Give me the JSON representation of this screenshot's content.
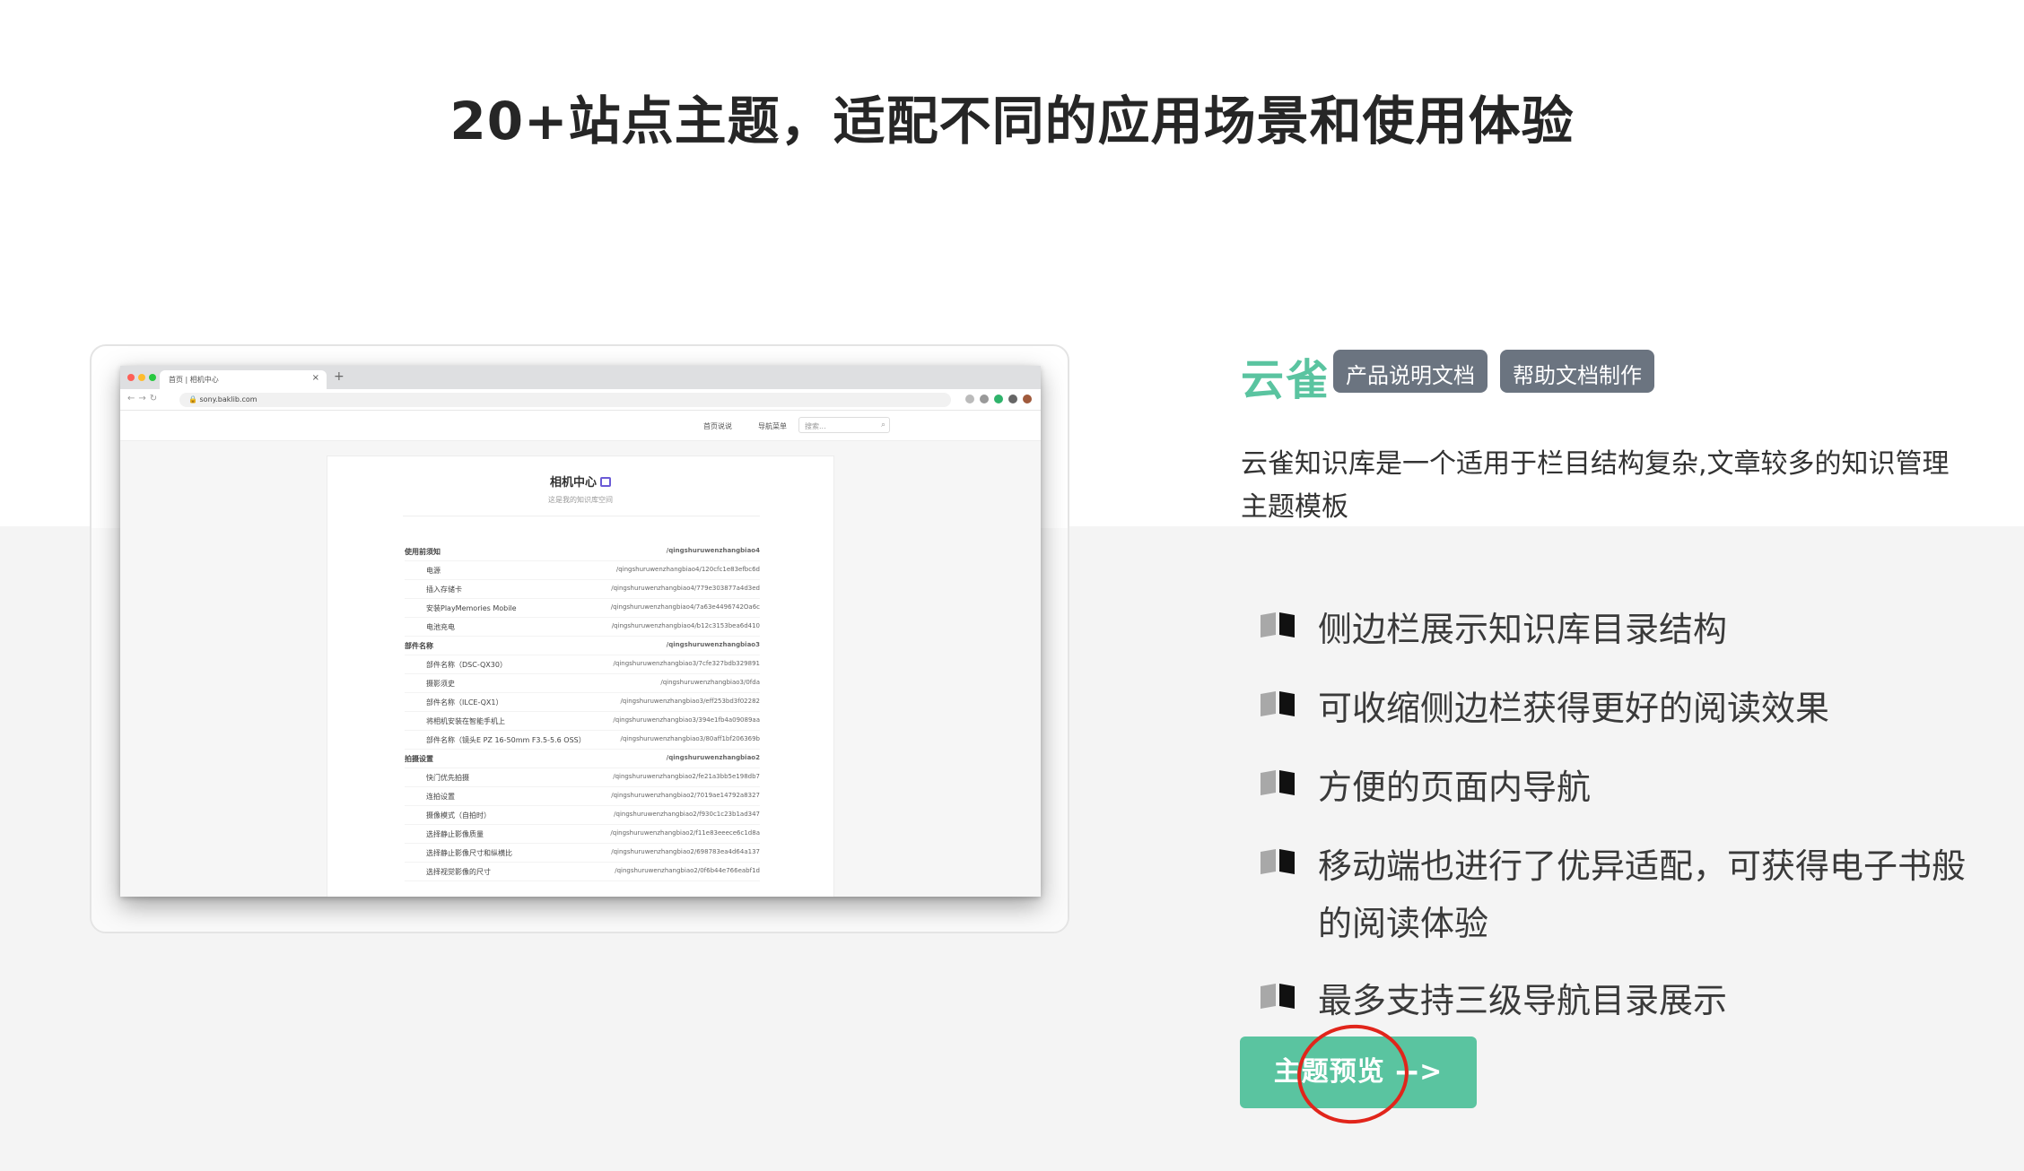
{
  "headline": "20+站点主题，适配不同的应用场景和使用体验",
  "colors": {
    "brand": "#5ac4a0",
    "tag_bg": "#6b7480",
    "annotation": "#e1251b"
  },
  "preview": {
    "tab_title": "首页 | 相机中心",
    "url": "sony.baklib.com",
    "menu_items": [
      "首页说说",
      "导航菜单"
    ],
    "search_placeholder": "搜索...",
    "site_title": "相机中心",
    "site_subtitle": "这是我的知识库空间",
    "rows": [
      {
        "level": 1,
        "title": "使用前须知",
        "path": "/qingshuruwenzhangbiao4"
      },
      {
        "level": 2,
        "title": "电源",
        "path": "/qingshuruwenzhangbiao4/120cfc1e83efbc6d"
      },
      {
        "level": 2,
        "title": "插入存储卡",
        "path": "/qingshuruwenzhangbiao4/779e303877a4d3ed"
      },
      {
        "level": 2,
        "title": "安装PlayMemories Mobile",
        "path": "/qingshuruwenzhangbiao4/7a63e4496742Oa6c"
      },
      {
        "level": 2,
        "title": "电池充电",
        "path": "/qingshuruwenzhangbiao4/b12c3153bea6d410"
      },
      {
        "level": 1,
        "title": "部件名称",
        "path": "/qingshuruwenzhangbiao3"
      },
      {
        "level": 2,
        "title": "部件名称（DSC-QX30）",
        "path": "/qingshuruwenzhangbiao3/7cfe327bdb329891"
      },
      {
        "level": 2,
        "title": "摄影须史",
        "path": "/qingshuruwenzhangbiao3/0fda"
      },
      {
        "level": 2,
        "title": "部件名称（ILCE-QX1）",
        "path": "/qingshuruwenzhangbiao3/eff253bd3f02282"
      },
      {
        "level": 2,
        "title": "将相机安装在智能手机上",
        "path": "/qingshuruwenzhangbiao3/394e1fb4a09089aa"
      },
      {
        "level": 2,
        "title": "部件名称（镜头E PZ 16-50mm F3.5-5.6 OSS）",
        "path": "/qingshuruwenzhangbiao3/80aff1bf206369b"
      },
      {
        "level": 1,
        "title": "拍摄设置",
        "path": "/qingshuruwenzhangbiao2"
      },
      {
        "level": 2,
        "title": "快门优先拍摄",
        "path": "/qingshuruwenzhangbiao2/fe21a3bb5e198db7"
      },
      {
        "level": 2,
        "title": "连拍设置",
        "path": "/qingshuruwenzhangbiao2/7019ae14792a8327"
      },
      {
        "level": 2,
        "title": "摄像模式（自拍时）",
        "path": "/qingshuruwenzhangbiao2/f930c1c23b1ad347"
      },
      {
        "level": 2,
        "title": "选择静止影像质量",
        "path": "/qingshuruwenzhangbiao2/f11e83eeece6c1d8a"
      },
      {
        "level": 2,
        "title": "选择静止影像尺寸和纵横比",
        "path": "/qingshuruwenzhangbiao2/698783ea4d64a137"
      },
      {
        "level": 2,
        "title": "选择视觉影像的尺寸",
        "path": "/qingshuruwenzhangbiao2/0f6b44e766eabf1d"
      }
    ]
  },
  "theme": {
    "brand_name": "云雀",
    "tags": [
      "产品说明文档",
      "帮助文档制作"
    ],
    "description": "云雀知识库是一个适用于栏目结构复杂,文章较多的知识管理主题模板",
    "features": [
      "侧边栏展示知识库目录结构",
      "可收缩侧边栏获得更好的阅读效果",
      "方便的页面内导航",
      "移动端也进行了优异适配，可获得电子书般的阅读体验",
      "最多支持三级导航目录展示"
    ],
    "preview_button": "主题预览 -->"
  }
}
